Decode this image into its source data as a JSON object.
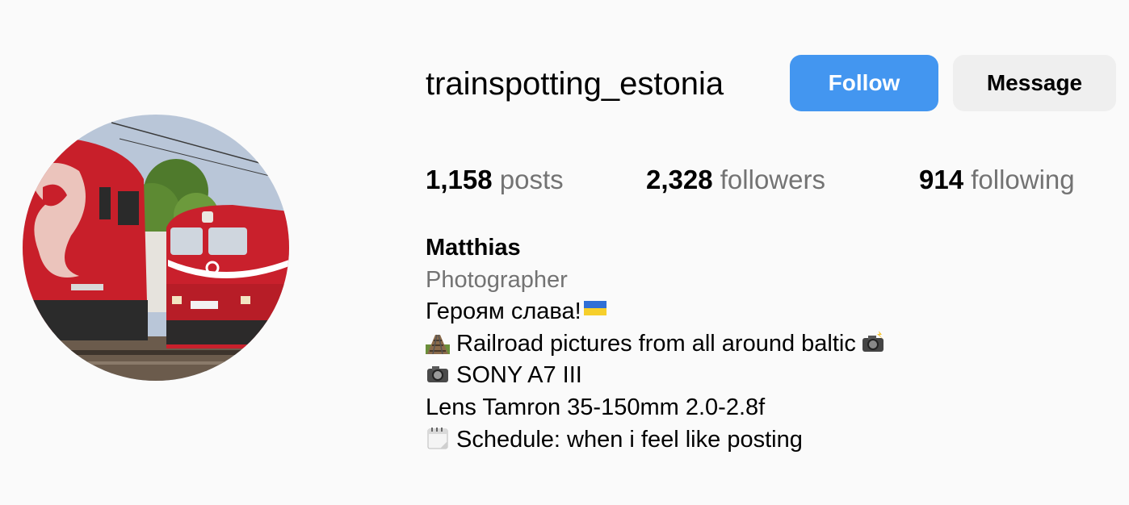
{
  "profile": {
    "username": "trainspotting_estonia",
    "avatar_icon": "profile-photo-red-locomotives"
  },
  "actions": {
    "follow_label": "Follow",
    "message_label": "Message",
    "follow_color": "#4396f0"
  },
  "stats": {
    "posts_count": "1,158",
    "posts_label": "posts",
    "followers_count": "2,328",
    "followers_label": "followers",
    "following_count": "914",
    "following_label": "following"
  },
  "bio": {
    "name": "Matthias",
    "category": "Photographer",
    "line1": "Героям слава!",
    "line1_emoji": "ukraine-flag-icon",
    "line2": "Railroad pictures from all around baltic",
    "line2_emoji_before": "railway-track-icon",
    "line2_emoji_after": "camera-flash-icon",
    "line3": "SONY A7 III",
    "line3_emoji": "camera-icon",
    "line4": "Lens Tamron 35-150mm 2.0-2.8f",
    "line5": "Schedule: when i feel like posting",
    "line5_emoji": "calendar-icon"
  }
}
